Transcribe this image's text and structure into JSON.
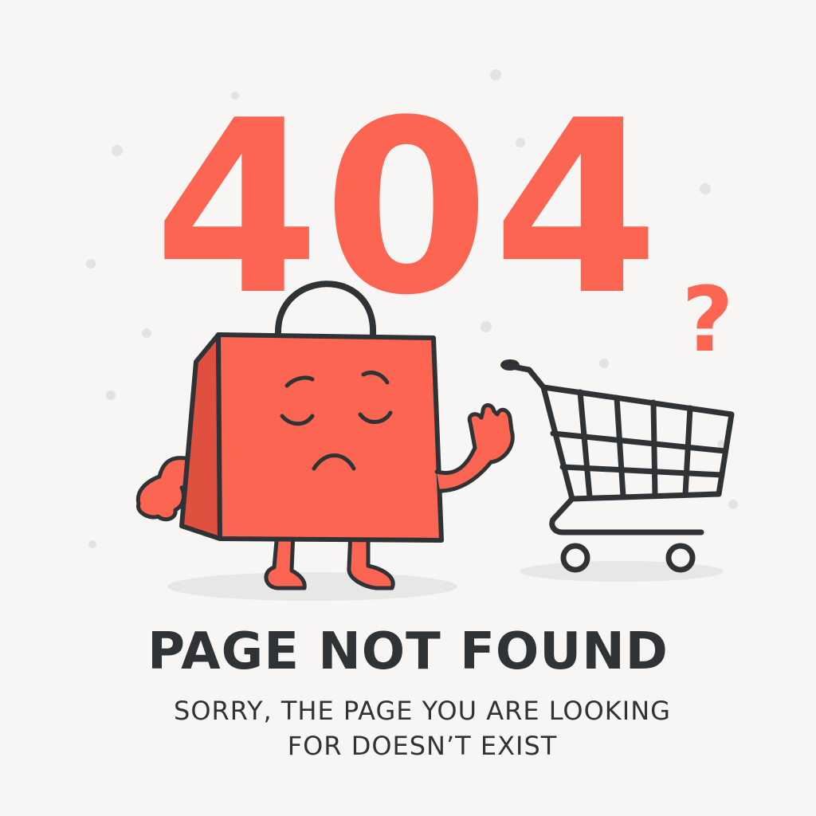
{
  "error_code": "404",
  "question_mark": "?",
  "heading": "PAGE NOT FOUND",
  "message_line_1": "SORRY, THE PAGE YOU ARE LOOKING",
  "message_line_2": "FOR DOESN’T EXIST",
  "icons": {
    "bag": "sad-shopping-bag-icon",
    "cart": "shopping-cart-icon"
  },
  "colors": {
    "accent": "#fd6553",
    "text": "#2f3336",
    "background": "#f7f6f4"
  }
}
